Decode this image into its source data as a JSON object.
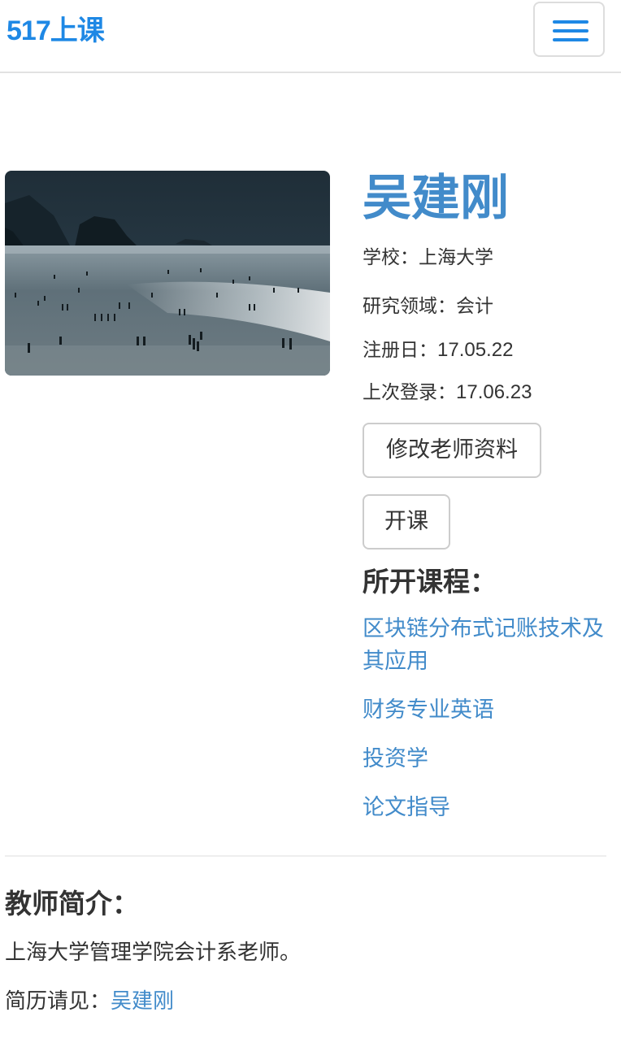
{
  "navbar": {
    "brand_num": "517",
    "brand_text": "上课",
    "menu_icon": "hamburger-menu-icon",
    "accent_color": "#1e88e5"
  },
  "teacher": {
    "name": "吴建刚",
    "school_label": "学校：",
    "school": "上海大学",
    "field_label": "研究领域：",
    "field": "会计",
    "registered_label": "注册日：",
    "registered": "17.05.22",
    "last_login_label": "上次登录：",
    "last_login": "17.06.23",
    "link_color": "#428bca"
  },
  "actions": {
    "edit_label": "修改老师资料",
    "open_label": "开课"
  },
  "courses": {
    "heading": "所开课程：",
    "items": [
      "区块链分布式记账技术及其应用",
      "财务专业英语",
      "投资学",
      "论文指导"
    ]
  },
  "intro": {
    "heading": "教师简介：",
    "text": "上海大学管理学院会计系老师。",
    "resume_label": "简历请见：",
    "resume_link": "吴建刚"
  }
}
